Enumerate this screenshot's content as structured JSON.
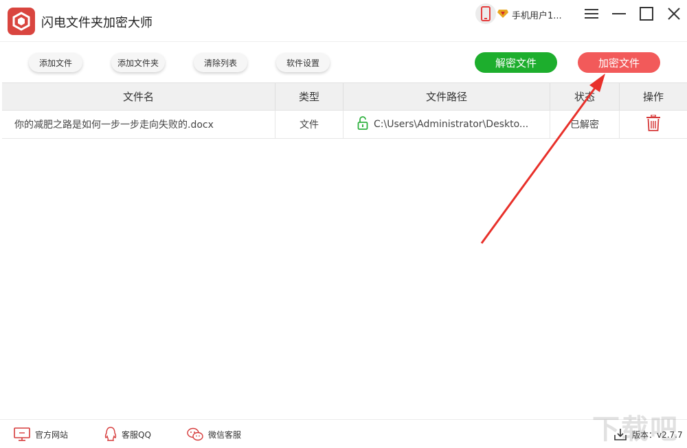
{
  "app": {
    "title": "闪电文件夹加密大师",
    "user_name": "手机用户1...",
    "accent_color": "#f25a5a"
  },
  "toolbar": {
    "add_file": "添加文件",
    "add_folder": "添加文件夹",
    "clear_list": "清除列表",
    "settings": "软件设置",
    "decrypt": "解密文件",
    "encrypt": "加密文件"
  },
  "table": {
    "headers": [
      "文件名",
      "类型",
      "文件路径",
      "状态",
      "操作"
    ],
    "rows": [
      {
        "name": "你的减肥之路是如何一步一步走向失败的.docx",
        "type": "文件",
        "path": "C:\\Users\\Administrator\\Deskto...",
        "status": "已解密"
      }
    ]
  },
  "footer": {
    "site": "官方网站",
    "qq": "客服QQ",
    "wechat": "微信客服",
    "version": "版本：v2.7.7"
  },
  "watermark": "下载吧",
  "colors": {
    "decrypt_button": "#1dae2d",
    "encrypt_button": "#f25a5a",
    "header_background": "#f0f0f0",
    "annotation_arrow": "#e8302a"
  }
}
